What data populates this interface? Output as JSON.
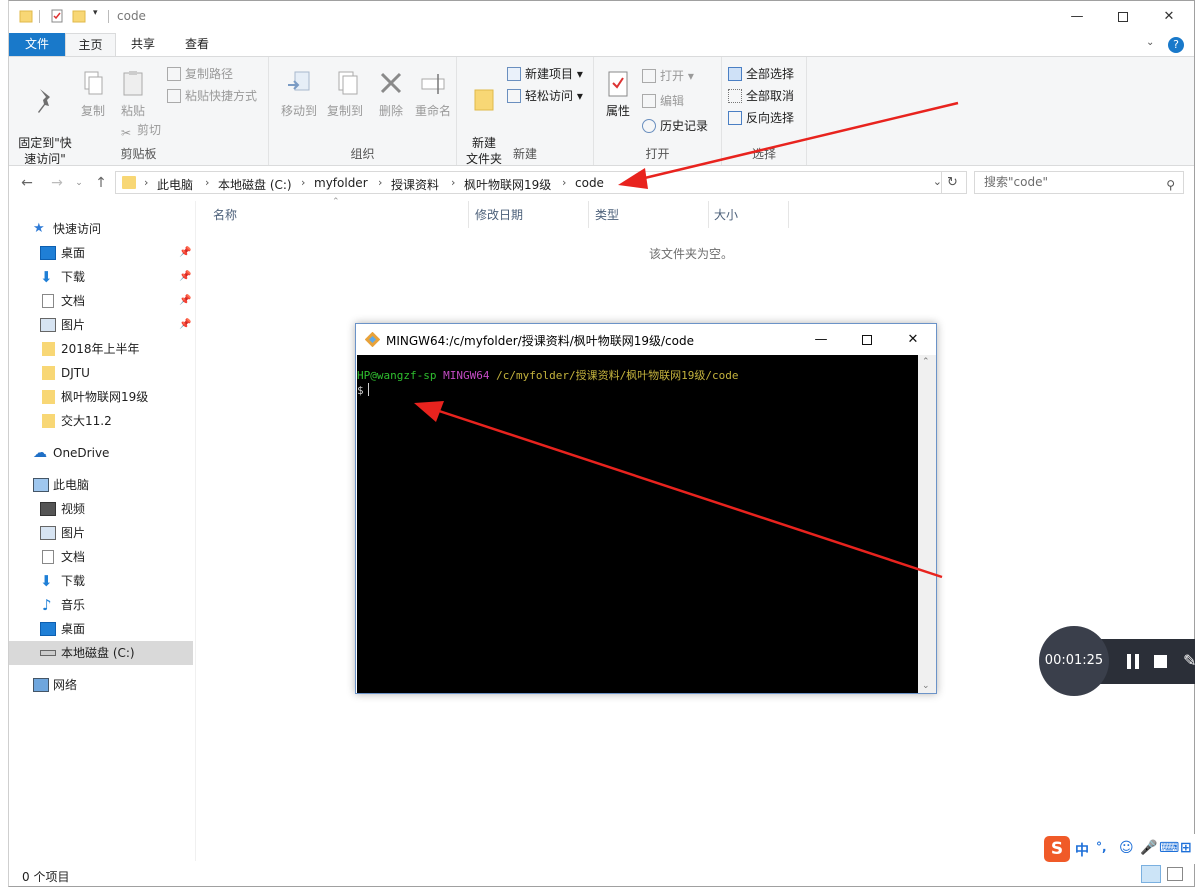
{
  "window": {
    "title": "code"
  },
  "tabs": {
    "file": "文件",
    "home": "主页",
    "share": "共享",
    "view": "查看"
  },
  "ribbon": {
    "clipboard": {
      "pin": "固定到\"快\n速访问\"",
      "copy": "复制",
      "paste": "粘贴",
      "copy_path": "复制路径",
      "paste_shortcut": "粘贴快捷方式",
      "cut": "剪切",
      "label": "剪贴板"
    },
    "organize": {
      "move_to": "移动到",
      "copy_to": "复制到",
      "delete": "删除",
      "rename": "重命名",
      "label": "组织"
    },
    "new": {
      "new_folder": "新建\n文件夹",
      "new_item": "新建项目 ▾",
      "easy_access": "轻松访问 ▾",
      "label": "新建"
    },
    "open": {
      "properties": "属性",
      "open": "打开 ▾",
      "edit": "编辑",
      "history": "历史记录",
      "label": "打开"
    },
    "select": {
      "select_all": "全部选择",
      "select_none": "全部取消",
      "invert": "反向选择",
      "label": "选择"
    }
  },
  "address": {
    "crumbs": [
      "此电脑",
      "本地磁盘 (C:)",
      "myfolder",
      "授课资料",
      "枫叶物联网19级",
      "code"
    ]
  },
  "search": {
    "placeholder": "搜索\"code\""
  },
  "nav": {
    "quick_access": "快速访问",
    "qa_items": [
      "桌面",
      "下载",
      "文档",
      "图片",
      "2018年上半年",
      "DJTU",
      "枫叶物联网19级",
      "交大11.2"
    ],
    "onedrive": "OneDrive",
    "this_pc": "此电脑",
    "pc_items": [
      "视频",
      "图片",
      "文档",
      "下载",
      "音乐",
      "桌面",
      "本地磁盘 (C:)"
    ],
    "network": "网络"
  },
  "columns": {
    "name": "名称",
    "modified": "修改日期",
    "type": "类型",
    "size": "大小"
  },
  "empty_message": "该文件夹为空。",
  "status": {
    "item_count": "0 个项目"
  },
  "terminal": {
    "title": "MINGW64:/c/myfolder/授课资料/枫叶物联网19级/code",
    "user": "HP@wangzf-sp",
    "env": "MINGW64",
    "path": "/c/myfolder/授课资料/枫叶物联网19级/code",
    "prompt": "$"
  },
  "recorder": {
    "time": "00:01:25"
  },
  "ime": {
    "mode": "中",
    "punct": "°,"
  },
  "colors": {
    "accent": "#1979ca",
    "annotation": "#e8231e"
  }
}
